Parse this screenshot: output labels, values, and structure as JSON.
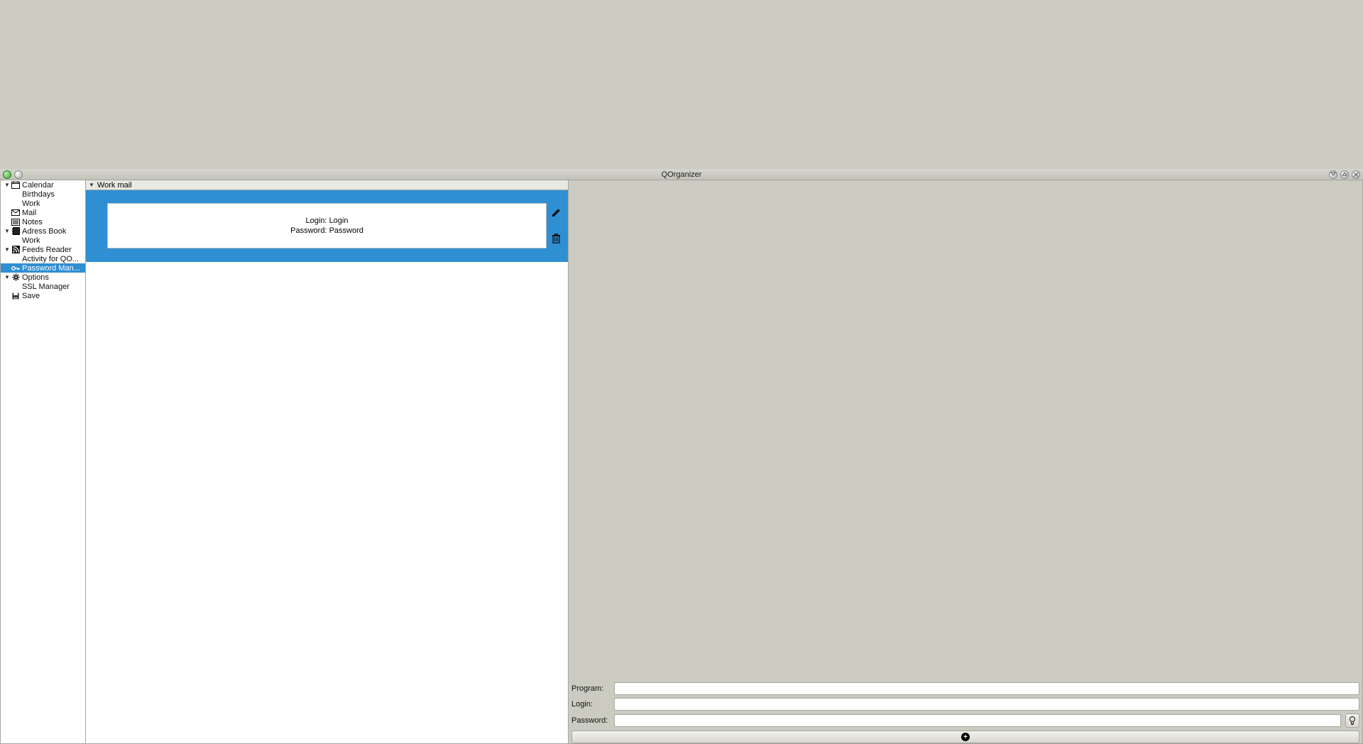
{
  "title_bar": {
    "app_title": "QOrganizer"
  },
  "sidebar": {
    "items": [
      {
        "label": "Calendar",
        "icon": "calendar",
        "expandable": true
      },
      {
        "label": "Birthdays",
        "child": true
      },
      {
        "label": "Work",
        "child": true
      },
      {
        "label": "Mail",
        "icon": "mail"
      },
      {
        "label": "Notes",
        "icon": "notes"
      },
      {
        "label": "Adress Book",
        "icon": "addressbook",
        "expandable": true
      },
      {
        "label": "Work",
        "child": true
      },
      {
        "label": "Feeds Reader",
        "icon": "feed",
        "expandable": true
      },
      {
        "label": "Activity for QO...",
        "child": true
      },
      {
        "label": "Password Man...",
        "icon": "key",
        "selected": true
      },
      {
        "label": "Options",
        "icon": "gear",
        "expandable": true
      },
      {
        "label": "SSL Manager",
        "child": true
      },
      {
        "label": "Save",
        "icon": "save"
      }
    ]
  },
  "middle": {
    "section_title": "Work mail",
    "entry": {
      "login_label": "Login:",
      "login_value": "Login",
      "password_label": "Password:",
      "password_value": "Password"
    }
  },
  "form": {
    "program_label": "Program:",
    "login_label": "Login:",
    "password_label": "Password:"
  }
}
